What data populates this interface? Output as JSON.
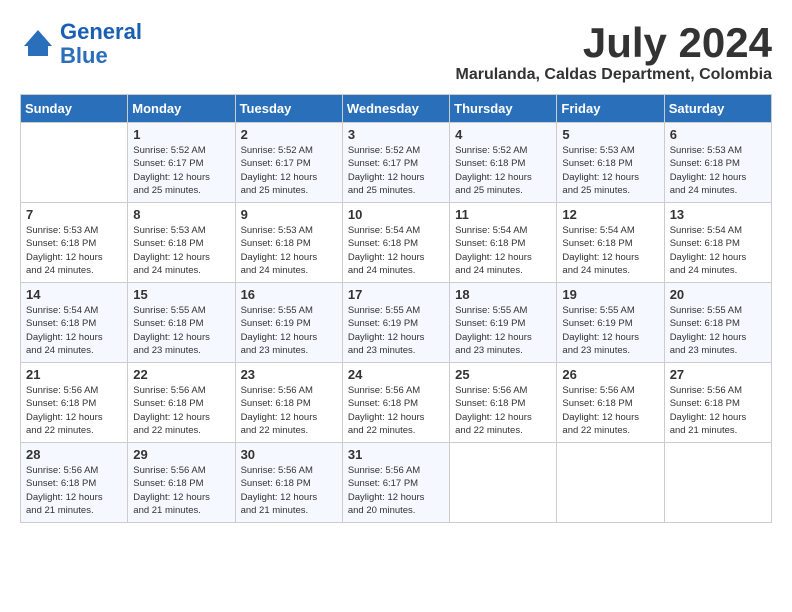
{
  "header": {
    "logo_line1": "General",
    "logo_line2": "Blue",
    "month_year": "July 2024",
    "location": "Marulanda, Caldas Department, Colombia"
  },
  "days_of_week": [
    "Sunday",
    "Monday",
    "Tuesday",
    "Wednesday",
    "Thursday",
    "Friday",
    "Saturday"
  ],
  "weeks": [
    [
      {
        "day": "",
        "info": ""
      },
      {
        "day": "1",
        "info": "Sunrise: 5:52 AM\nSunset: 6:17 PM\nDaylight: 12 hours\nand 25 minutes."
      },
      {
        "day": "2",
        "info": "Sunrise: 5:52 AM\nSunset: 6:17 PM\nDaylight: 12 hours\nand 25 minutes."
      },
      {
        "day": "3",
        "info": "Sunrise: 5:52 AM\nSunset: 6:17 PM\nDaylight: 12 hours\nand 25 minutes."
      },
      {
        "day": "4",
        "info": "Sunrise: 5:52 AM\nSunset: 6:18 PM\nDaylight: 12 hours\nand 25 minutes."
      },
      {
        "day": "5",
        "info": "Sunrise: 5:53 AM\nSunset: 6:18 PM\nDaylight: 12 hours\nand 25 minutes."
      },
      {
        "day": "6",
        "info": "Sunrise: 5:53 AM\nSunset: 6:18 PM\nDaylight: 12 hours\nand 24 minutes."
      }
    ],
    [
      {
        "day": "7",
        "info": "Sunrise: 5:53 AM\nSunset: 6:18 PM\nDaylight: 12 hours\nand 24 minutes."
      },
      {
        "day": "8",
        "info": "Sunrise: 5:53 AM\nSunset: 6:18 PM\nDaylight: 12 hours\nand 24 minutes."
      },
      {
        "day": "9",
        "info": "Sunrise: 5:53 AM\nSunset: 6:18 PM\nDaylight: 12 hours\nand 24 minutes."
      },
      {
        "day": "10",
        "info": "Sunrise: 5:54 AM\nSunset: 6:18 PM\nDaylight: 12 hours\nand 24 minutes."
      },
      {
        "day": "11",
        "info": "Sunrise: 5:54 AM\nSunset: 6:18 PM\nDaylight: 12 hours\nand 24 minutes."
      },
      {
        "day": "12",
        "info": "Sunrise: 5:54 AM\nSunset: 6:18 PM\nDaylight: 12 hours\nand 24 minutes."
      },
      {
        "day": "13",
        "info": "Sunrise: 5:54 AM\nSunset: 6:18 PM\nDaylight: 12 hours\nand 24 minutes."
      }
    ],
    [
      {
        "day": "14",
        "info": "Sunrise: 5:54 AM\nSunset: 6:18 PM\nDaylight: 12 hours\nand 24 minutes."
      },
      {
        "day": "15",
        "info": "Sunrise: 5:55 AM\nSunset: 6:18 PM\nDaylight: 12 hours\nand 23 minutes."
      },
      {
        "day": "16",
        "info": "Sunrise: 5:55 AM\nSunset: 6:19 PM\nDaylight: 12 hours\nand 23 minutes."
      },
      {
        "day": "17",
        "info": "Sunrise: 5:55 AM\nSunset: 6:19 PM\nDaylight: 12 hours\nand 23 minutes."
      },
      {
        "day": "18",
        "info": "Sunrise: 5:55 AM\nSunset: 6:19 PM\nDaylight: 12 hours\nand 23 minutes."
      },
      {
        "day": "19",
        "info": "Sunrise: 5:55 AM\nSunset: 6:19 PM\nDaylight: 12 hours\nand 23 minutes."
      },
      {
        "day": "20",
        "info": "Sunrise: 5:55 AM\nSunset: 6:18 PM\nDaylight: 12 hours\nand 23 minutes."
      }
    ],
    [
      {
        "day": "21",
        "info": "Sunrise: 5:56 AM\nSunset: 6:18 PM\nDaylight: 12 hours\nand 22 minutes."
      },
      {
        "day": "22",
        "info": "Sunrise: 5:56 AM\nSunset: 6:18 PM\nDaylight: 12 hours\nand 22 minutes."
      },
      {
        "day": "23",
        "info": "Sunrise: 5:56 AM\nSunset: 6:18 PM\nDaylight: 12 hours\nand 22 minutes."
      },
      {
        "day": "24",
        "info": "Sunrise: 5:56 AM\nSunset: 6:18 PM\nDaylight: 12 hours\nand 22 minutes."
      },
      {
        "day": "25",
        "info": "Sunrise: 5:56 AM\nSunset: 6:18 PM\nDaylight: 12 hours\nand 22 minutes."
      },
      {
        "day": "26",
        "info": "Sunrise: 5:56 AM\nSunset: 6:18 PM\nDaylight: 12 hours\nand 22 minutes."
      },
      {
        "day": "27",
        "info": "Sunrise: 5:56 AM\nSunset: 6:18 PM\nDaylight: 12 hours\nand 21 minutes."
      }
    ],
    [
      {
        "day": "28",
        "info": "Sunrise: 5:56 AM\nSunset: 6:18 PM\nDaylight: 12 hours\nand 21 minutes."
      },
      {
        "day": "29",
        "info": "Sunrise: 5:56 AM\nSunset: 6:18 PM\nDaylight: 12 hours\nand 21 minutes."
      },
      {
        "day": "30",
        "info": "Sunrise: 5:56 AM\nSunset: 6:18 PM\nDaylight: 12 hours\nand 21 minutes."
      },
      {
        "day": "31",
        "info": "Sunrise: 5:56 AM\nSunset: 6:17 PM\nDaylight: 12 hours\nand 20 minutes."
      },
      {
        "day": "",
        "info": ""
      },
      {
        "day": "",
        "info": ""
      },
      {
        "day": "",
        "info": ""
      }
    ]
  ]
}
